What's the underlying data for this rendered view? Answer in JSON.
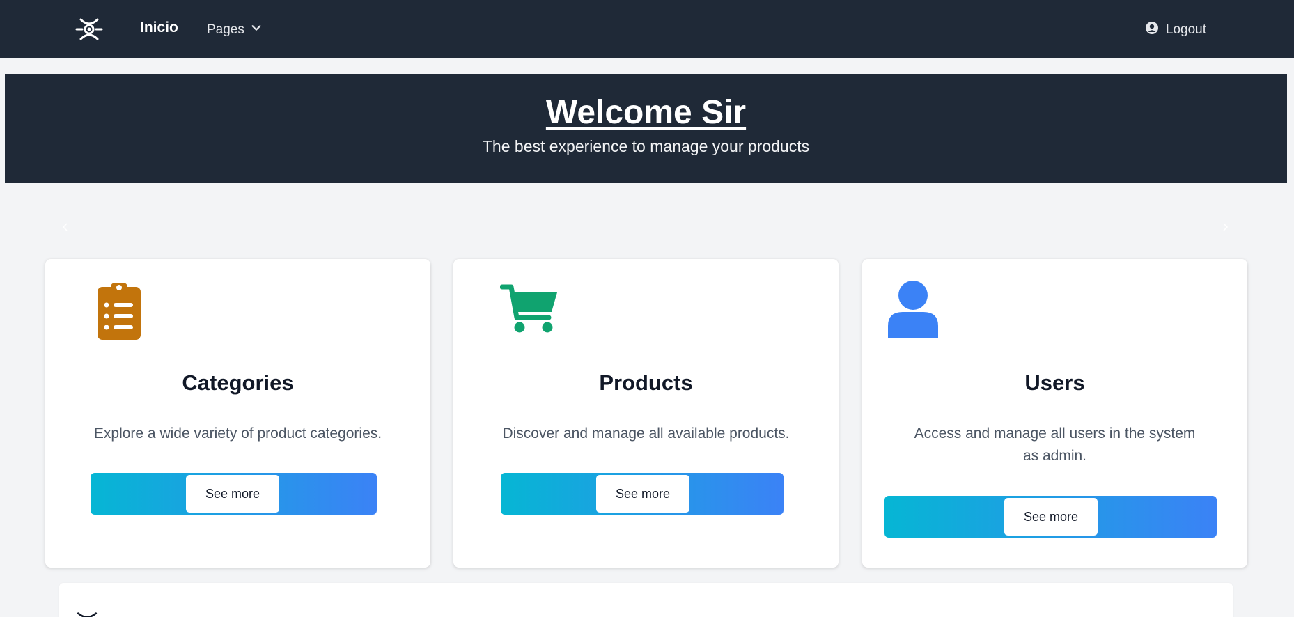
{
  "navbar": {
    "logo_icon": "spider-logo-icon",
    "home_label": "Inicio",
    "pages_label": "Pages",
    "logout_label": "Logout"
  },
  "hero": {
    "title": "Welcome Sir",
    "subtitle": "The best experience to manage your products"
  },
  "carousel": {
    "prev_icon": "chevron-left-icon",
    "next_icon": "chevron-right-icon"
  },
  "cards": [
    {
      "icon": "clipboard-list-icon",
      "icon_color": "#c2740c",
      "title": "Categories",
      "description": "Explore a wide variety of product categories.",
      "button_label": "See more"
    },
    {
      "icon": "shopping-cart-icon",
      "icon_color": "#10a36f",
      "title": "Products",
      "description": "Discover and manage all available products.",
      "button_label": "See more"
    },
    {
      "icon": "user-icon",
      "icon_color": "#3b82f6",
      "title": "Users",
      "description": "Access and manage all users in the system as admin.",
      "button_label": "See more"
    }
  ],
  "colors": {
    "nav_bg": "#1f2937",
    "page_bg": "#f3f4f6",
    "gradient_start": "#06b6d4",
    "gradient_end": "#3b82f6"
  }
}
